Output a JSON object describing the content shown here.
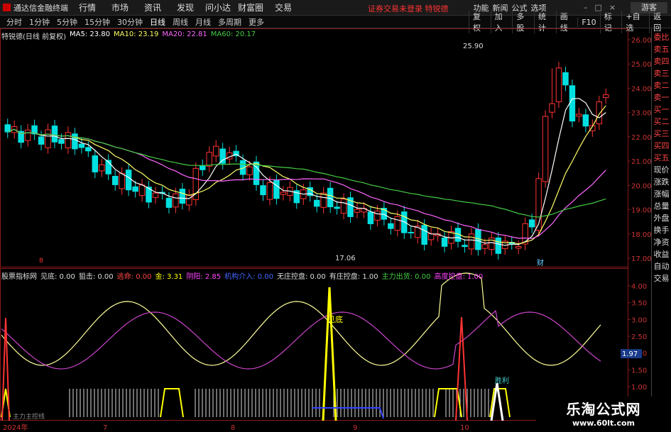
{
  "app": {
    "logo_text": "通达信金融终端",
    "notice": "证券交易未登录 特锐德",
    "guest": "游客"
  },
  "menu": [
    "行情",
    "市场",
    "资讯",
    "发现",
    "问小达",
    "财富圈",
    "交易"
  ],
  "top_right": [
    "功能",
    "新闻",
    "公式",
    "选项"
  ],
  "periods": [
    "分时",
    "1分钟",
    "5分钟",
    "15分钟",
    "30分钟",
    "日线",
    "周线",
    "月线",
    "多周期",
    "更多"
  ],
  "active_period": "日线",
  "tools": [
    "复权",
    "加入",
    "多股",
    "统计",
    "画线",
    "F10",
    "标记",
    "+自选",
    "返回"
  ],
  "main_header": {
    "title": "特锐德(日线 前复权)",
    "ma5": "MA5: 23.80",
    "ma10": "MA10: 23.19",
    "ma20": "MA20: 22.81",
    "ma60": "MA60: 20.17"
  },
  "indicator_header": {
    "title": "股票指标网",
    "items": [
      {
        "label": "见底: 0.00",
        "color": "#dddddd"
      },
      {
        "label": "狙击: 0.00",
        "color": "#dddddd"
      },
      {
        "label": "逃命: 0.00",
        "color": "#ff4444"
      },
      {
        "label": "金: 3.31",
        "color": "#ffff00"
      },
      {
        "label": "阴阳: 2.85",
        "color": "#ff44ff"
      },
      {
        "label": "机构介入: 0.00",
        "color": "#4466ff"
      },
      {
        "label": "无庄控盘: 0.00",
        "color": "#dddddd"
      },
      {
        "label": "有庄控盘: 1.00",
        "color": "#dddddd"
      },
      {
        "label": "主力出货: 0.00",
        "color": "#44cc44"
      },
      {
        "label": "高度控盘: 1.00",
        "color": "#ff44ff"
      }
    ]
  },
  "price_axis": [
    "26.00",
    "25.00",
    "24.00",
    "23.00",
    "22.00",
    "21.00",
    "20.00",
    "19.00",
    "18.00",
    "17.00"
  ],
  "ind_axis": [
    "4.00",
    "3.50",
    "3.00",
    "2.50",
    "2.00",
    "1.50",
    "1.00"
  ],
  "ind_marker": "1.97",
  "date_labels": [
    "2024年",
    "7",
    "8",
    "9",
    "10"
  ],
  "annotations": {
    "high": "25.90",
    "low": "17.06",
    "cai": "财",
    "jiandi": "见底",
    "shengli": "胜利",
    "jibiao": "8",
    "zhuli": "主力主控线"
  },
  "sidebar": [
    {
      "label": "委比",
      "color": "red"
    },
    {
      "label": "卖五",
      "color": "red"
    },
    {
      "label": "卖四",
      "color": "red"
    },
    {
      "label": "卖三",
      "color": "red"
    },
    {
      "label": "卖二",
      "color": "red"
    },
    {
      "label": "卖一",
      "color": "red"
    },
    {
      "label": "买一",
      "color": "red"
    },
    {
      "label": "买二",
      "color": "red"
    },
    {
      "label": "买三",
      "color": "red"
    },
    {
      "label": "买四",
      "color": "red"
    },
    {
      "label": "买五",
      "color": "red"
    },
    {
      "label": "现价",
      "color": "white"
    },
    {
      "label": "涨跌",
      "color": "white"
    },
    {
      "label": "涨幅",
      "color": "white"
    },
    {
      "label": "总量",
      "color": "white"
    },
    {
      "label": "外盘",
      "color": "white"
    },
    {
      "label": "换手",
      "color": "white"
    },
    {
      "label": "净资",
      "color": "white"
    },
    {
      "label": "收益",
      "color": "white"
    },
    {
      "label": "自动",
      "color": "white"
    },
    {
      "label": "交易",
      "color": "white"
    }
  ],
  "watermark": {
    "title": "乐淘公式网",
    "url": "www.60lt.com"
  },
  "colors": {
    "up": "#ff3333",
    "down": "#00e0e0",
    "ma5": "#ffffff",
    "ma10": "#ffff66",
    "ma20": "#ff66ff",
    "ma60": "#44cc44"
  }
}
